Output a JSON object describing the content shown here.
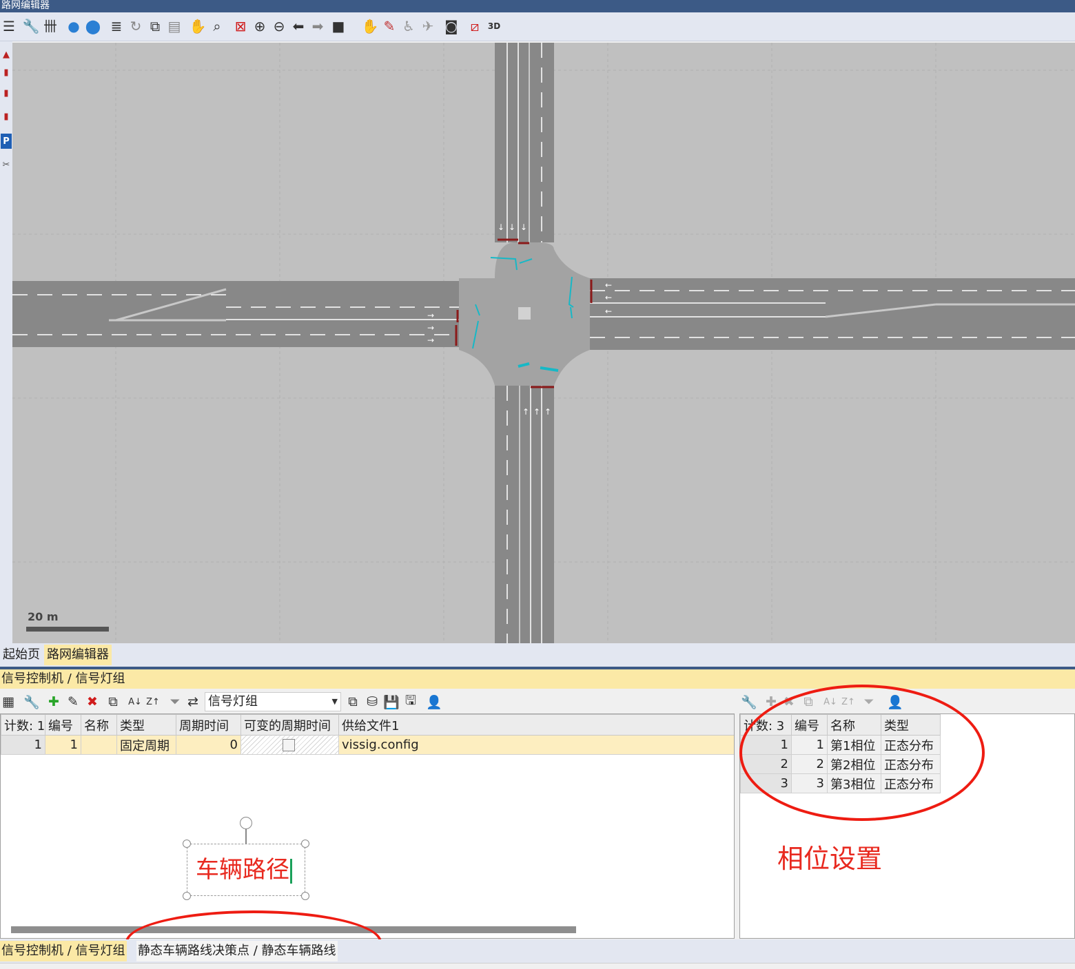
{
  "window": {
    "title": "路网编辑器"
  },
  "toolbar_icons": [
    "menu-icon",
    "wrench-icon",
    "grid-icon",
    "globe-icon",
    "map-pin-icon",
    "list-icon",
    "refresh-icon",
    "copy-icon",
    "clipboard-icon",
    "hand-pan-icon",
    "zoom-area-icon",
    "zoom-fit-icon",
    "zoom-in-icon",
    "zoom-out-icon",
    "arrow-left-icon",
    "arrow-right-icon",
    "camera-icon",
    "hand-grab-icon",
    "ruler-icon",
    "pedestrian-icon",
    "plane-icon",
    "screenshot-icon",
    "3d-box-icon",
    "3d-view-icon"
  ],
  "canvas": {
    "scale_label": "20 m",
    "colors": {
      "background": "#c0c0c0",
      "road": "#888888",
      "marking": "#ffffff",
      "stopline": "#8b1a1a",
      "conflict": "#17b8c6"
    }
  },
  "doc_tabs": [
    "起始页",
    "路网编辑器"
  ],
  "panel": {
    "title": "信号控制机 / 信号灯组"
  },
  "left_list": {
    "combo_value": "信号灯组",
    "headers": [
      "计数: 1",
      "编号",
      "名称",
      "类型",
      "周期时间",
      "可变的周期时间",
      "供给文件1"
    ],
    "rows": [
      {
        "idx": "1",
        "no": "1",
        "name": "",
        "type": "固定周期",
        "cycle": "0",
        "supply": "vissig.config"
      }
    ]
  },
  "right_list": {
    "headers": [
      "计数: 3",
      "编号",
      "名称",
      "类型"
    ],
    "rows": [
      {
        "idx": "1",
        "no": "1",
        "name": "第1相位",
        "type": "正态分布"
      },
      {
        "idx": "2",
        "no": "2",
        "name": "第2相位",
        "type": "正态分布"
      },
      {
        "idx": "3",
        "no": "3",
        "name": "第3相位",
        "type": "正态分布"
      }
    ]
  },
  "annotations": {
    "vehicle_route": "车辆路径",
    "phase_setting": "相位设置",
    "ellipse_color": "#ee1c12"
  },
  "bottom_tabs": {
    "active": "信号控制机 / 信号灯组",
    "other": "静态车辆路线决策点 / 静态车辆路线"
  }
}
